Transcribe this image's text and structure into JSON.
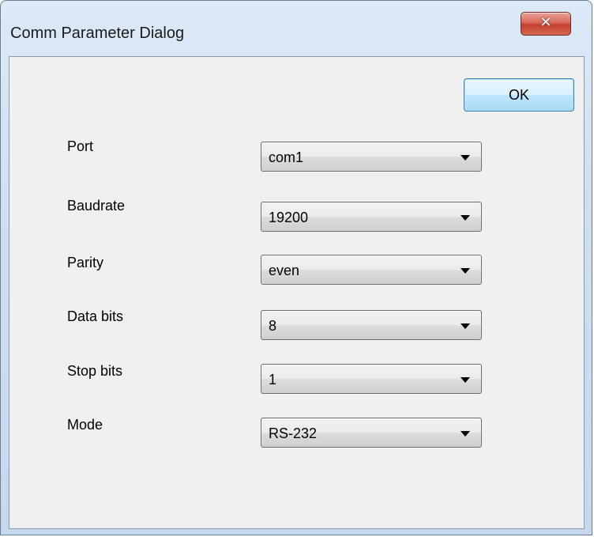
{
  "window": {
    "title": "Comm Parameter Dialog",
    "close_glyph": "✕"
  },
  "buttons": {
    "ok_label": "OK"
  },
  "fields": [
    {
      "label": "Port",
      "value": "com1"
    },
    {
      "label": "Baudrate",
      "value": "19200"
    },
    {
      "label": "Parity",
      "value": "even"
    },
    {
      "label": "Data bits",
      "value": "8"
    },
    {
      "label": "Stop bits",
      "value": "1"
    },
    {
      "label": "Mode",
      "value": "RS-232"
    }
  ],
  "colors": {
    "close_button": "#c5402f",
    "ok_border": "#3c7fb1",
    "client_bg": "#f0f0f0"
  },
  "icons": {
    "close": "close-icon",
    "dropdown": "chevron-down-icon"
  }
}
